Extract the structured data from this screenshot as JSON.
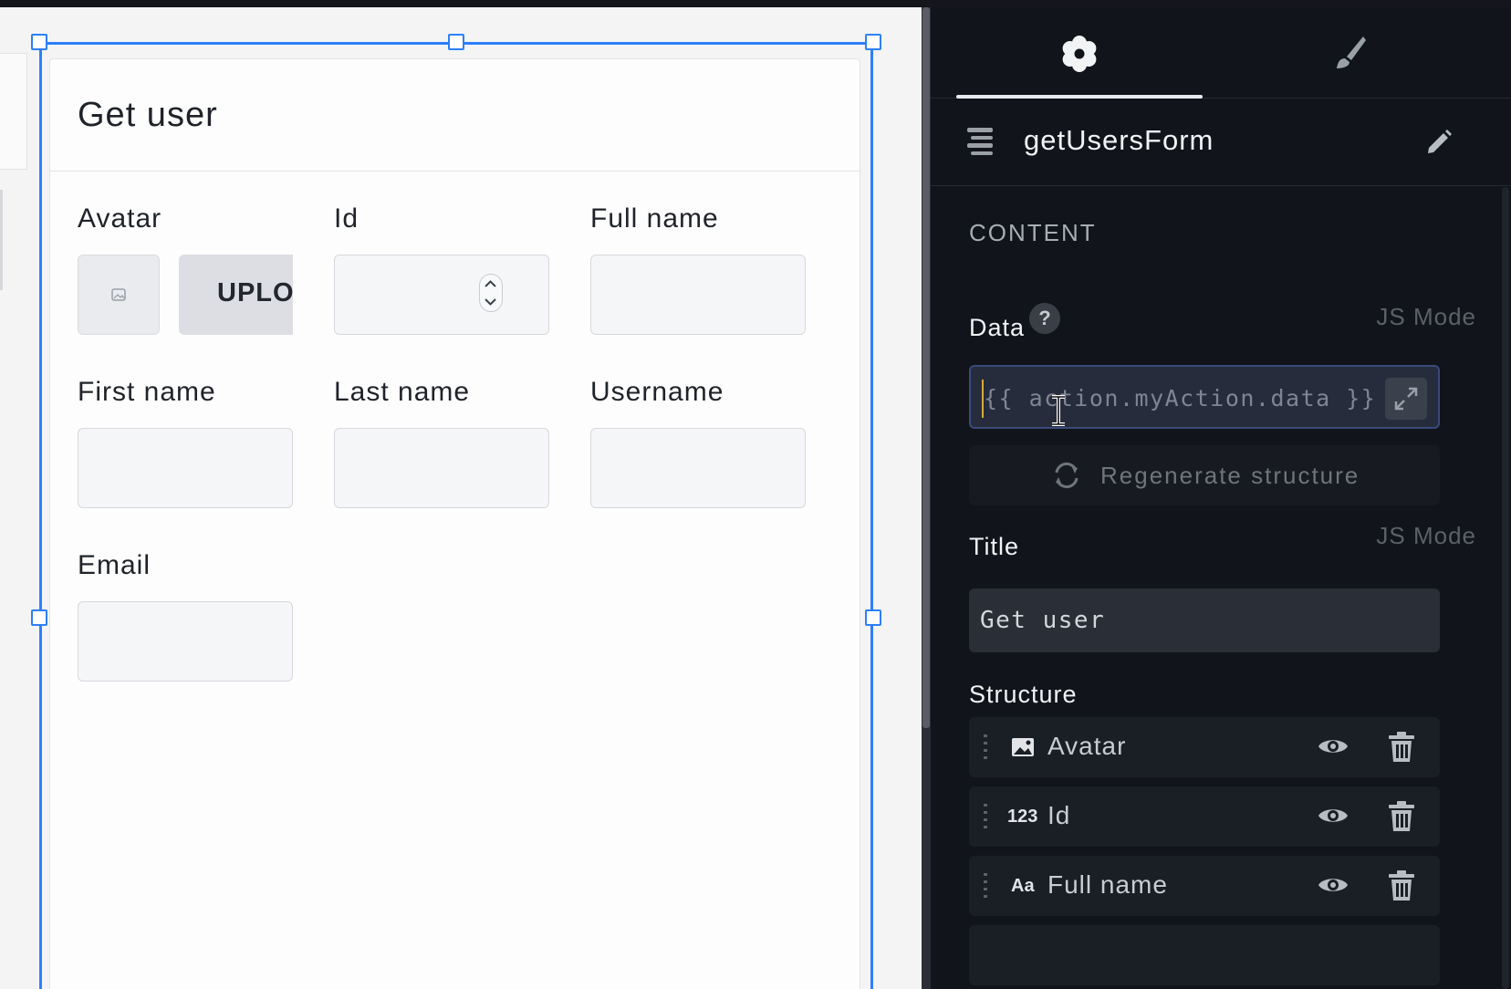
{
  "form": {
    "title": "Get user",
    "fields": {
      "avatar": {
        "label": "Avatar",
        "upload_label": "UPLOAD"
      },
      "id": {
        "label": "Id"
      },
      "full_name": {
        "label": "Full name"
      },
      "first_name": {
        "label": "First name"
      },
      "last_name": {
        "label": "Last name"
      },
      "username": {
        "label": "Username"
      },
      "email": {
        "label": "Email"
      }
    }
  },
  "panel": {
    "tabs": [
      {
        "name": "settings",
        "icon": "gear-icon",
        "active": true
      },
      {
        "name": "style",
        "icon": "brush-icon",
        "active": false
      }
    ],
    "widget_name": "getUsersForm",
    "section_title": "CONTENT",
    "data": {
      "label": "Data",
      "help": "?",
      "js_mode": "JS Mode",
      "value": "{{ action.myAction.data }}"
    },
    "regenerate_label": "Regenerate structure",
    "title_prop": {
      "label": "Title",
      "js_mode": "JS Mode",
      "value": "Get user"
    },
    "structure": {
      "label": "Structure",
      "items": [
        {
          "name": "Avatar",
          "type_icon": "image-icon"
        },
        {
          "name": "Id",
          "type_icon": "123"
        },
        {
          "name": "Full name",
          "type_icon": "Aa"
        }
      ]
    }
  },
  "colors": {
    "selection": "#2d7ff9",
    "panel_bg": "#11141a",
    "canvas_bg": "#f4f4f5"
  }
}
